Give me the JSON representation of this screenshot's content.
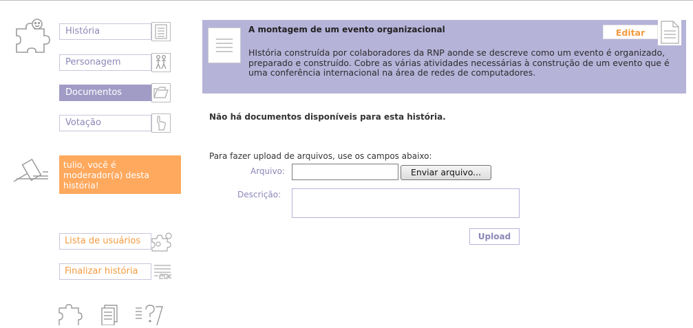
{
  "nav": {
    "items": [
      {
        "label": "História",
        "icon": "document-lines-icon",
        "active": false
      },
      {
        "label": "Personagem",
        "icon": "people-icon",
        "active": false
      },
      {
        "label": "Documentos",
        "icon": "folder-icon",
        "active": true
      },
      {
        "label": "Votação",
        "icon": "hand-icon",
        "active": false
      }
    ]
  },
  "moderator": {
    "message": "tulio, você é moderador(a) desta história!",
    "icon": "gavel-icon"
  },
  "actions": {
    "user_list": "Lista de usuários",
    "finish_story": "Finalizar história"
  },
  "story": {
    "title": "A montagem de um evento organizacional",
    "description": "HIstória construída por colaboradores da RNP aonde se descreve como um evento é organizado, preparado e construído. Cobre as várias atividades necessárias à construção de um evento que é uma conferência internacional na área de redes de computadores.",
    "edit_label": "Editar"
  },
  "documents": {
    "empty_message": "Não há documentos disponíveis para esta história."
  },
  "upload": {
    "intro": "Para fazer upload de arquivos, use os campos abaixo:",
    "file_label": "Arquivo:",
    "file_value": "",
    "send_file_label": "Enviar arquivo...",
    "description_label": "Descrição:",
    "description_value": "",
    "submit_label": "Upload"
  },
  "colors": {
    "accent_purple": "#a19cc6",
    "panel_purple": "#b6b3d9",
    "accent_orange": "#ffa95e",
    "label_purple": "#8b87b8",
    "text_orange": "#f39a3f"
  }
}
